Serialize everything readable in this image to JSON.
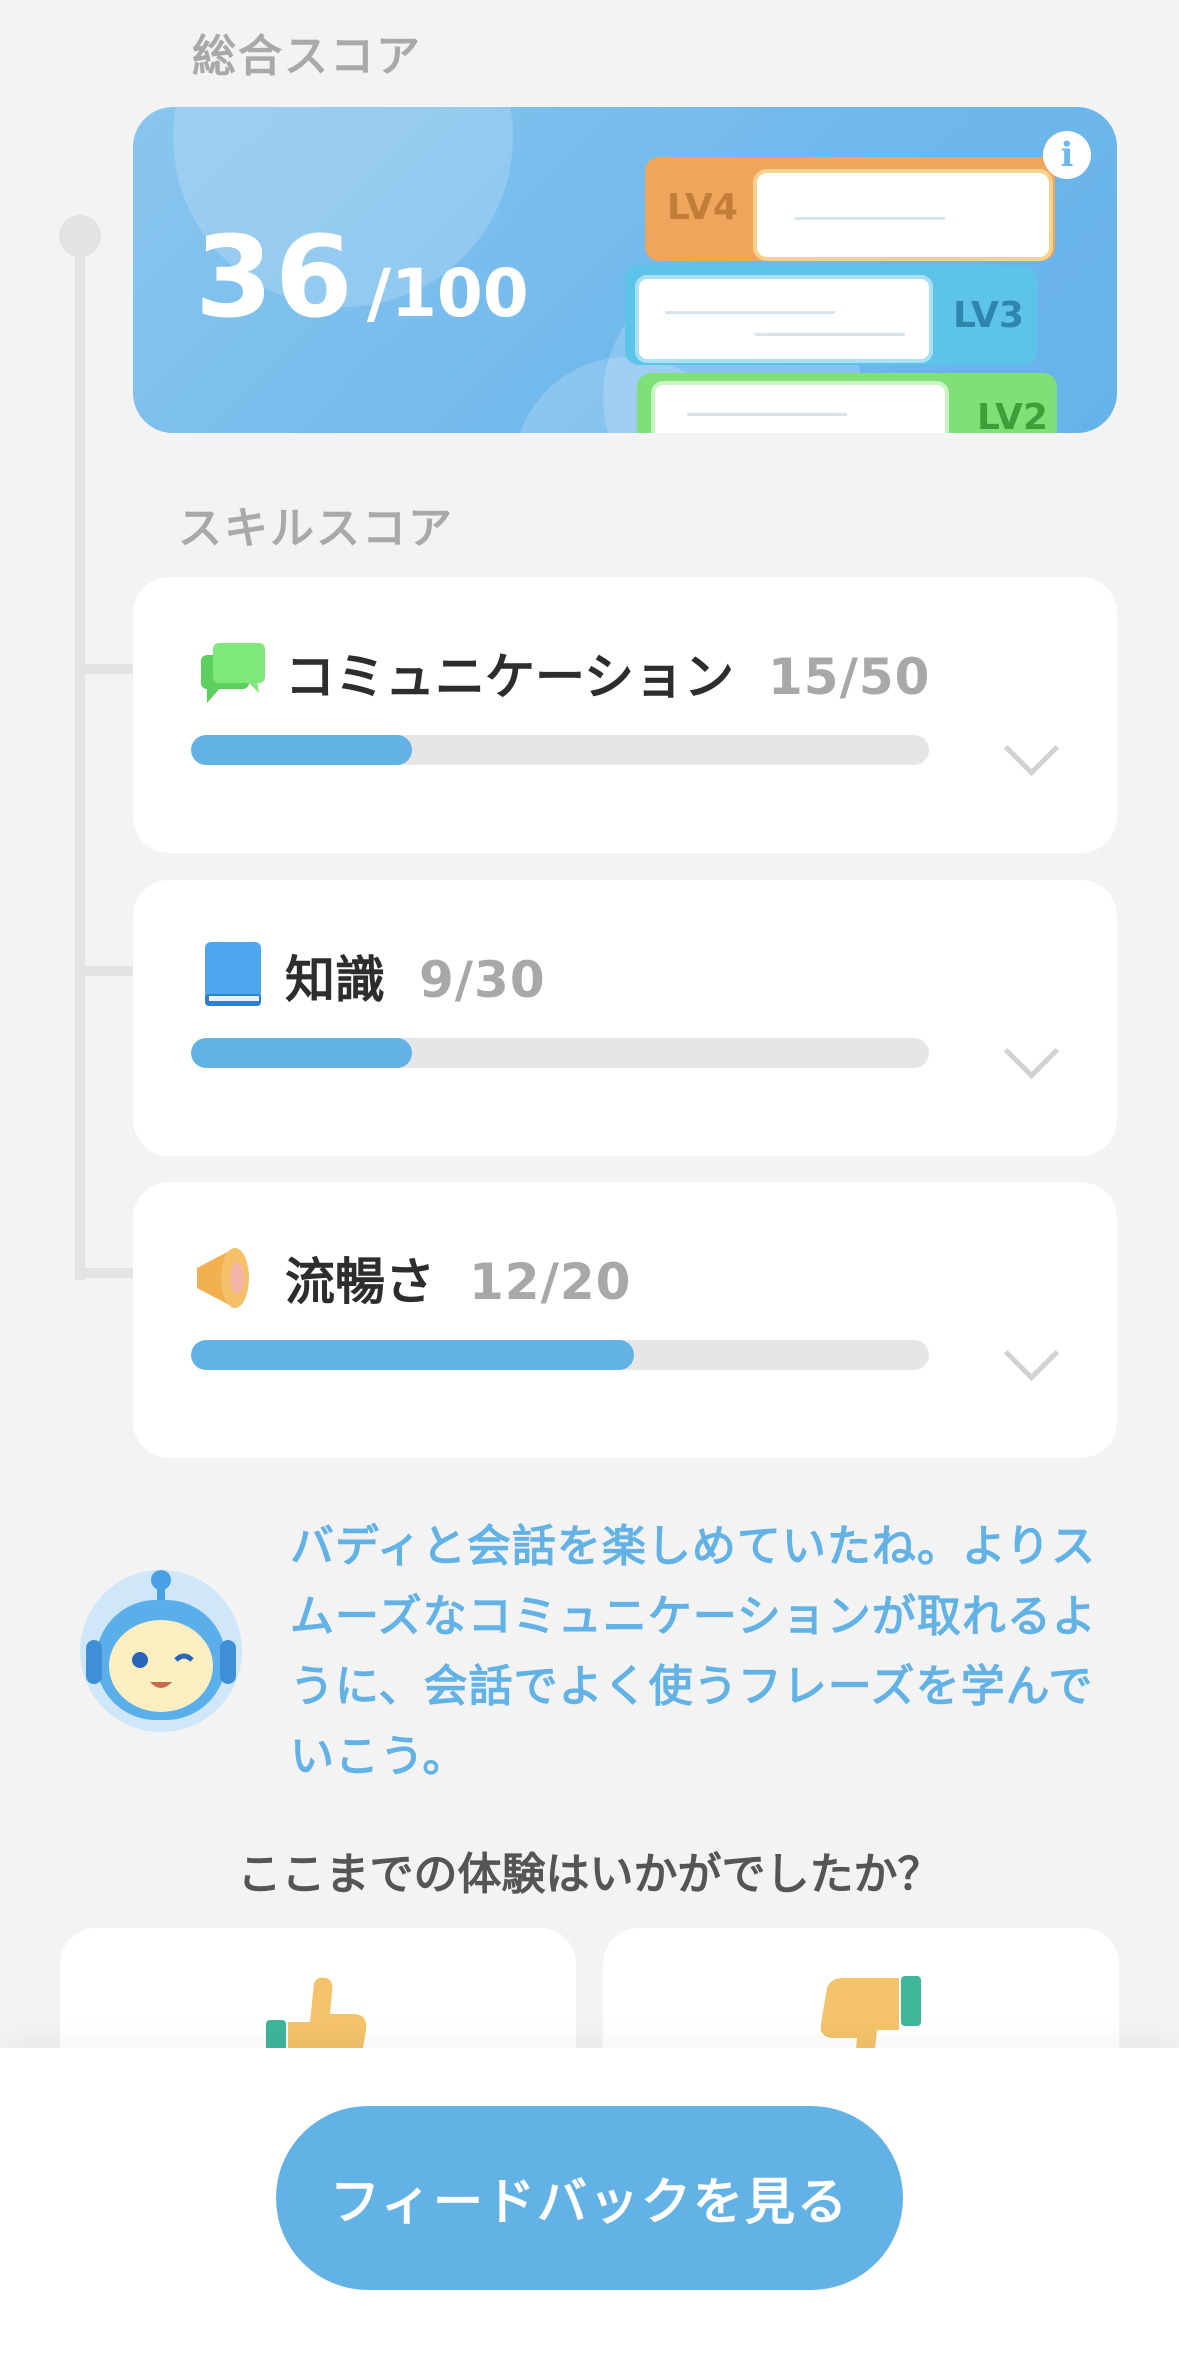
{
  "overall": {
    "section_label": "総合スコア",
    "score": "36",
    "max": "/100",
    "books": [
      "LV4",
      "LV3",
      "LV2"
    ]
  },
  "skills": {
    "section_label": "スキルスコア",
    "items": [
      {
        "name": "コミュニケーション",
        "score": "15/50",
        "progress": 0.3
      },
      {
        "name": "知識",
        "score": "9/30",
        "progress": 0.3
      },
      {
        "name": "流暢さ",
        "score": "12/20",
        "progress": 0.6
      }
    ]
  },
  "message": {
    "text": "バディと会話を楽しめていたね。よりスムーズなコミュニケーションが取れるように、会話でよく使うフレーズを学んでいこう。"
  },
  "rating": {
    "question": "ここまでの体験はいかがでしたか？"
  },
  "footer": {
    "button_label": "フィードバックを見る"
  },
  "colors": {
    "accent": "#62b2e6",
    "score_card": "#6fb8ec"
  }
}
